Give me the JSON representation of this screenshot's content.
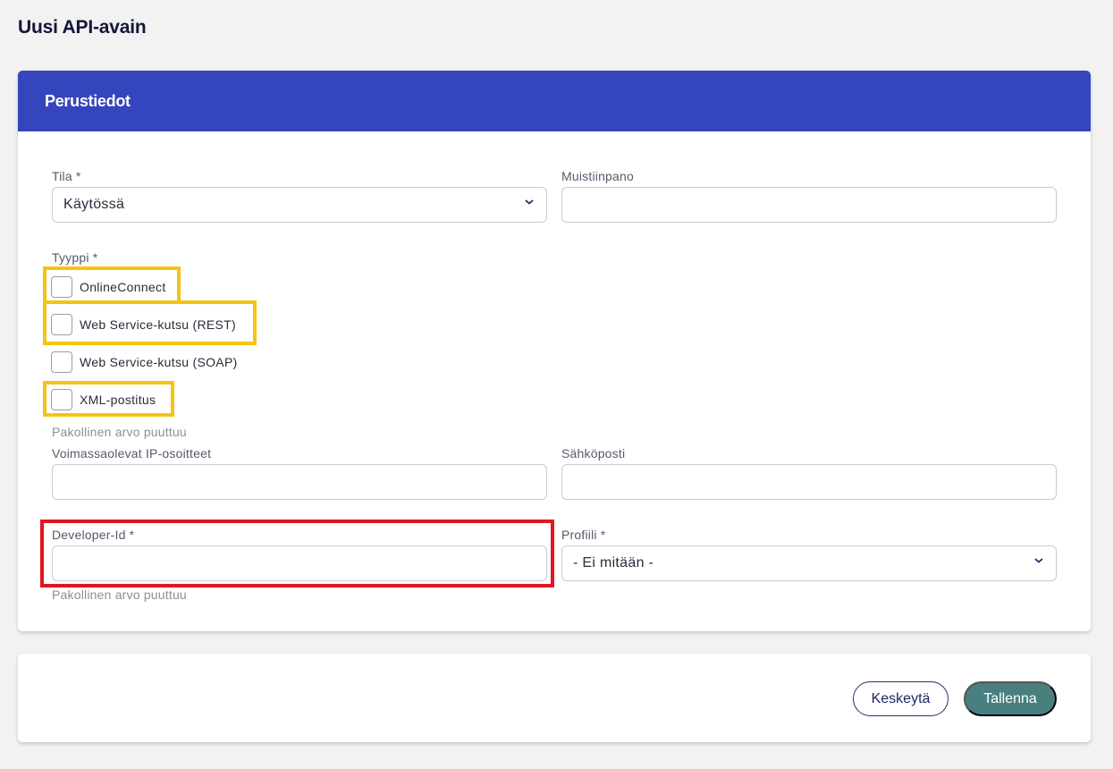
{
  "page": {
    "title": "Uusi API-avain"
  },
  "section": {
    "header": "Perustiedot"
  },
  "form": {
    "tila": {
      "label": "Tila *",
      "value": "Käytössä"
    },
    "muistiinpano": {
      "label": "Muistiinpano",
      "value": ""
    },
    "tyyppi": {
      "label": "Tyyppi *",
      "options": [
        {
          "label": "OnlineConnect",
          "checked": false
        },
        {
          "label": "Web Service-kutsu (REST)",
          "checked": false
        },
        {
          "label": "Web Service-kutsu (SOAP)",
          "checked": false
        },
        {
          "label": "XML-postitus",
          "checked": false
        }
      ],
      "error": "Pakollinen arvo puuttuu"
    },
    "ip": {
      "label": "Voimassaolevat IP-osoitteet",
      "value": ""
    },
    "email": {
      "label": "Sähköposti",
      "value": ""
    },
    "developer": {
      "label": "Developer-Id *",
      "value": "",
      "error": "Pakollinen arvo puuttuu"
    },
    "profiili": {
      "label": "Profiili *",
      "value": "- Ei mitään -"
    }
  },
  "buttons": {
    "cancel": "Keskeytä",
    "save": "Tallenna"
  },
  "colors": {
    "header": "#3545bd",
    "save": "#4a7f80",
    "highlight_yellow": "#f6c313",
    "highlight_red": "#e0171f"
  },
  "icons": {
    "select_arrow": "chevron-down-icon"
  }
}
